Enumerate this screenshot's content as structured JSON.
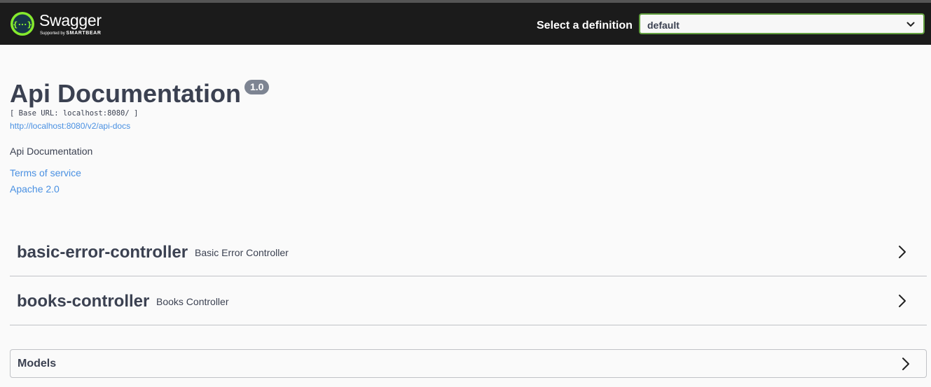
{
  "topbar": {
    "logo": {
      "icon": "swagger-logo-icon",
      "glyph": "{···}",
      "name": "Swagger",
      "supported_by": "Supported by",
      "vendor": "SMARTBEAR"
    },
    "definition_label": "Select a definition",
    "definition_selected": "default"
  },
  "info": {
    "title": "Api Documentation",
    "version": "1.0",
    "base_url": "[ Base URL: localhost:8080/ ]",
    "spec_url": "http://localhost:8080/v2/api-docs",
    "description": "Api Documentation",
    "terms_link": "Terms of service",
    "license_link": "Apache 2.0"
  },
  "tags": [
    {
      "name": "basic-error-controller",
      "description": "Basic Error Controller"
    },
    {
      "name": "books-controller",
      "description": "Books Controller"
    }
  ],
  "models": {
    "label": "Models"
  },
  "colors": {
    "topbar_bg": "#1b1b1b",
    "accent_green": "#62a03f",
    "logo_green": "#85ea2d",
    "link": "#4990e2",
    "text": "#3b4151",
    "badge": "#7d8492"
  }
}
